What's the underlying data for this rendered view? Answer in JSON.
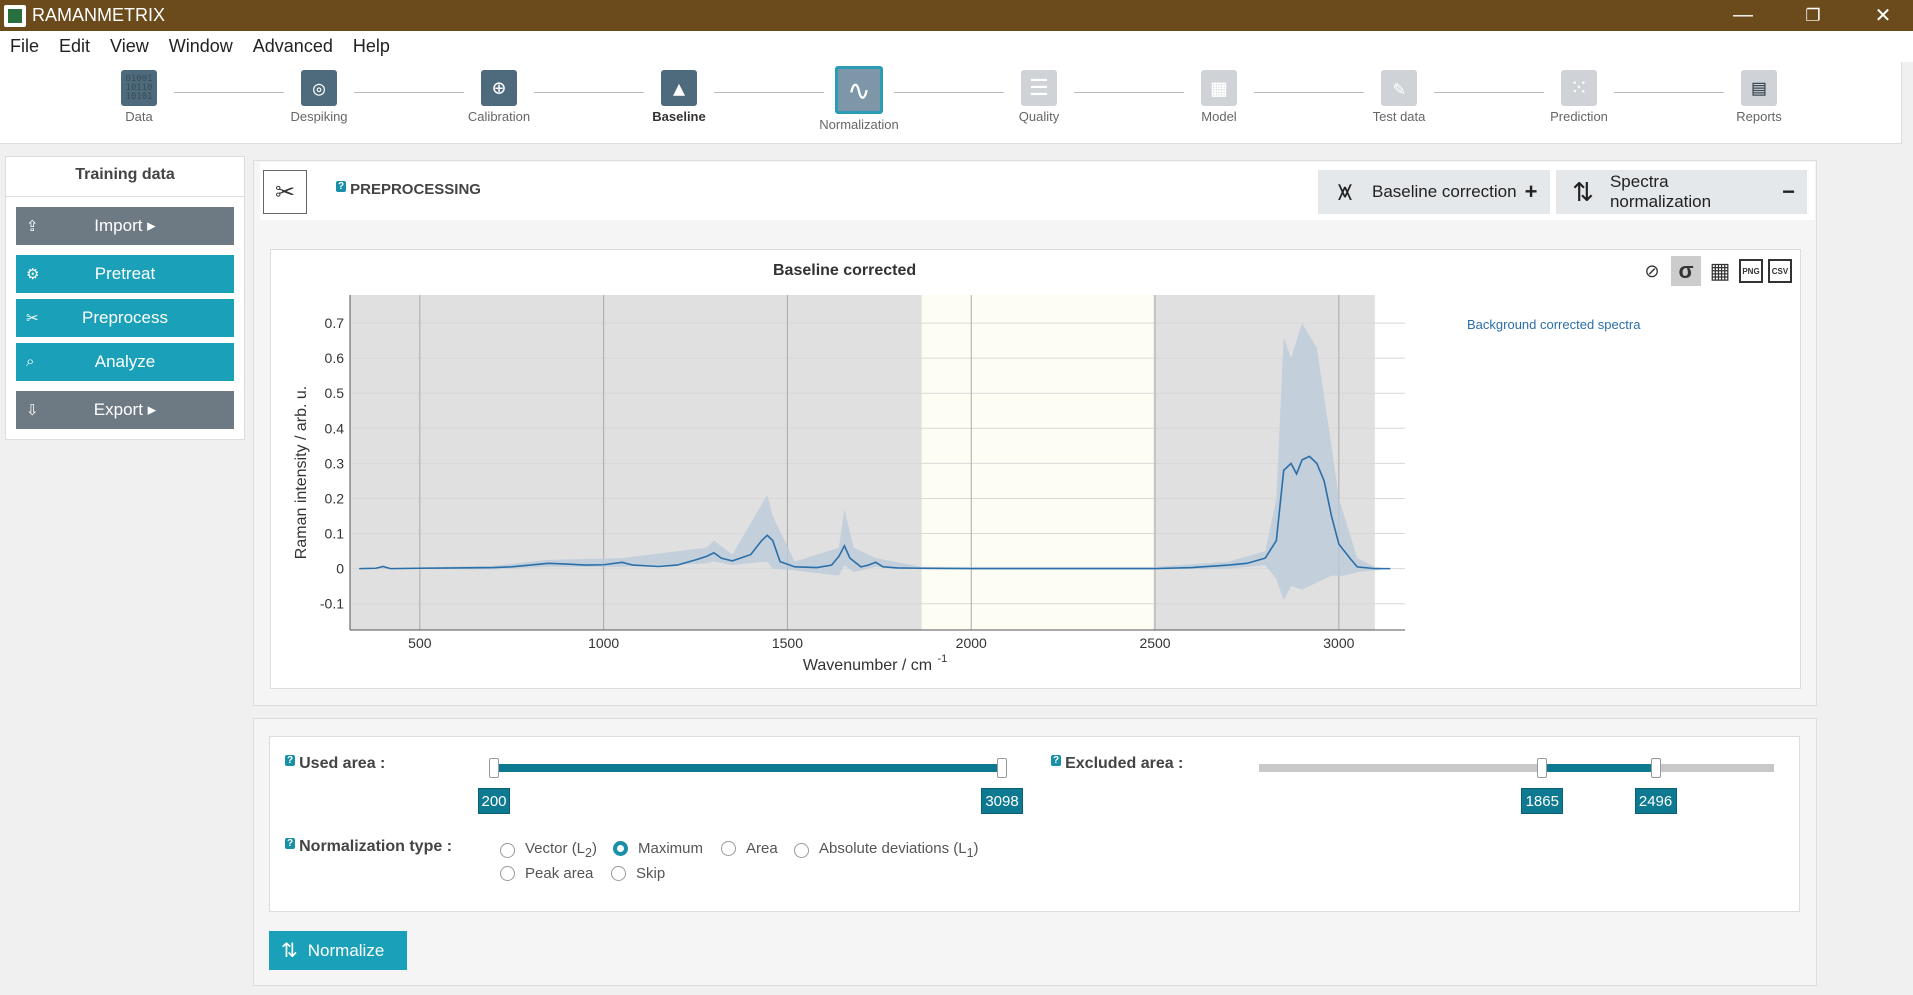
{
  "window": {
    "title": "RAMANMETRIX",
    "minimize": "—",
    "restore": "❐",
    "close": "✕"
  },
  "menu": [
    "File",
    "Edit",
    "View",
    "Window",
    "Advanced",
    "Help"
  ],
  "steps": [
    {
      "label": "Data",
      "icon": "binary-data-icon",
      "glyph": "01001 10110 10101"
    },
    {
      "label": "Despiking",
      "icon": "despiking-icon",
      "glyph": "◎"
    },
    {
      "label": "Calibration",
      "icon": "calibration-icon",
      "glyph": "⊕"
    },
    {
      "label": "Baseline",
      "icon": "baseline-icon",
      "glyph": "▲"
    },
    {
      "label": "Normalization",
      "icon": "normalization-icon",
      "glyph": "∿"
    },
    {
      "label": "Quality",
      "icon": "quality-icon",
      "glyph": "☰"
    },
    {
      "label": "Model",
      "icon": "model-icon",
      "glyph": "▦"
    },
    {
      "label": "Test data",
      "icon": "test-data-icon",
      "glyph": "✎"
    },
    {
      "label": "Prediction",
      "icon": "prediction-icon",
      "glyph": "⁙"
    },
    {
      "label": "Reports",
      "icon": "reports-icon",
      "glyph": "▤"
    }
  ],
  "sidebar": {
    "header": "Training data",
    "buttons": [
      {
        "label": "Import ▸",
        "icon": "upload-icon",
        "glyph": "⇪"
      },
      {
        "label": "Pretreat",
        "icon": "pretreat-icon",
        "glyph": "⚙"
      },
      {
        "label": "Preprocess",
        "icon": "preprocess-icon",
        "glyph": "✂"
      },
      {
        "label": "Analyze",
        "icon": "analyze-icon",
        "glyph": "⌕"
      },
      {
        "label": "Export ▸",
        "icon": "download-icon",
        "glyph": "⇩"
      }
    ]
  },
  "preprocessing": {
    "title": "PREPROCESSING",
    "help": "?",
    "baseline_btn": "Baseline correction",
    "baseline_sign": "+",
    "norm_btn": "Spectra normalization",
    "norm_sign": "−"
  },
  "chart_tools": {
    "png": "PNG",
    "csv": "CSV"
  },
  "chart_data": {
    "type": "line",
    "title": "Baseline corrected",
    "xlabel": "Wavenumber / cm",
    "xlabel_sup": "-1",
    "ylabel": "Raman intensity / arb. u.",
    "xlim": [
      310,
      3180
    ],
    "ylim": [
      -0.175,
      0.78
    ],
    "x_ticks": [
      500,
      1000,
      1500,
      2000,
      2500,
      3000
    ],
    "y_ticks": [
      -0.1,
      0,
      0.1,
      0.2,
      0.3,
      0.4,
      0.5,
      0.6,
      0.7
    ],
    "excluded_region": [
      1865,
      2496
    ],
    "grayed_region": [
      310,
      3098
    ],
    "grid": true,
    "legend_position": "right",
    "series": [
      {
        "name": "Background corrected spectra",
        "color": "#2b6fa8",
        "band_color": "#b9cad9",
        "points": [
          [
            335,
            0
          ],
          [
            380,
            0.001
          ],
          [
            400,
            0.006
          ],
          [
            420,
            0
          ],
          [
            500,
            0.001
          ],
          [
            600,
            0.002
          ],
          [
            700,
            0.003
          ],
          [
            750,
            0.005
          ],
          [
            800,
            0.01
          ],
          [
            850,
            0.015
          ],
          [
            900,
            0.013
          ],
          [
            950,
            0.01
          ],
          [
            1000,
            0.011
          ],
          [
            1050,
            0.018
          ],
          [
            1080,
            0.01
          ],
          [
            1150,
            0.006
          ],
          [
            1200,
            0.01
          ],
          [
            1250,
            0.025
          ],
          [
            1280,
            0.035
          ],
          [
            1300,
            0.045
          ],
          [
            1320,
            0.03
          ],
          [
            1350,
            0.022
          ],
          [
            1400,
            0.04
          ],
          [
            1430,
            0.08
          ],
          [
            1445,
            0.095
          ],
          [
            1460,
            0.08
          ],
          [
            1480,
            0.02
          ],
          [
            1520,
            0.005
          ],
          [
            1580,
            0.003
          ],
          [
            1620,
            0.01
          ],
          [
            1640,
            0.035
          ],
          [
            1655,
            0.065
          ],
          [
            1670,
            0.03
          ],
          [
            1700,
            0.005
          ],
          [
            1720,
            0.01
          ],
          [
            1740,
            0.018
          ],
          [
            1760,
            0.005
          ],
          [
            1800,
            0.002
          ],
          [
            1865,
            0.001
          ],
          [
            2000,
            0
          ],
          [
            2496,
            0
          ],
          [
            2600,
            0.003
          ],
          [
            2700,
            0.01
          ],
          [
            2750,
            0.015
          ],
          [
            2800,
            0.03
          ],
          [
            2830,
            0.08
          ],
          [
            2850,
            0.28
          ],
          [
            2870,
            0.3
          ],
          [
            2885,
            0.27
          ],
          [
            2900,
            0.31
          ],
          [
            2920,
            0.32
          ],
          [
            2940,
            0.3
          ],
          [
            2960,
            0.25
          ],
          [
            2980,
            0.15
          ],
          [
            3000,
            0.07
          ],
          [
            3015,
            0.05
          ],
          [
            3030,
            0.03
          ],
          [
            3050,
            0.005
          ],
          [
            3098,
            0
          ],
          [
            3140,
            0
          ]
        ],
        "band": [
          [
            335,
            0,
            0
          ],
          [
            700,
            0.008,
            -0.002
          ],
          [
            850,
            0.025,
            0.005
          ],
          [
            1050,
            0.03,
            0.005
          ],
          [
            1280,
            0.06,
            0.015
          ],
          [
            1300,
            0.08,
            0.02
          ],
          [
            1350,
            0.04,
            0.01
          ],
          [
            1445,
            0.21,
            0.02
          ],
          [
            1460,
            0.15,
            0.0
          ],
          [
            1520,
            0.02,
            -0.005
          ],
          [
            1640,
            0.06,
            -0.02
          ],
          [
            1655,
            0.17,
            0.01
          ],
          [
            1680,
            0.06,
            -0.01
          ],
          [
            1740,
            0.03,
            0.005
          ],
          [
            1865,
            0.005,
            -0.002
          ],
          [
            2496,
            0.005,
            -0.002
          ],
          [
            2700,
            0.02,
            0.0
          ],
          [
            2800,
            0.05,
            0.01
          ],
          [
            2830,
            0.2,
            -0.03
          ],
          [
            2850,
            0.66,
            -0.09
          ],
          [
            2870,
            0.6,
            -0.05
          ],
          [
            2900,
            0.7,
            -0.06
          ],
          [
            2940,
            0.63,
            -0.04
          ],
          [
            2980,
            0.35,
            -0.02
          ],
          [
            3000,
            0.2,
            -0.02
          ],
          [
            3015,
            0.15,
            -0.02
          ],
          [
            3050,
            0.03,
            -0.01
          ],
          [
            3098,
            0.005,
            -0.005
          ],
          [
            3140,
            0,
            0
          ]
        ]
      }
    ]
  },
  "controls": {
    "used_area_label": "Used area :",
    "used_min": "200",
    "used_max": "3098",
    "used_fraction": [
      0.0,
      1.0
    ],
    "excluded_area_label": "Excluded area :",
    "excluded_min": "1865",
    "excluded_max": "2496",
    "excluded_fraction": [
      0.55,
      0.77
    ],
    "normalization_label": "Normalization type :",
    "options": [
      {
        "label": "Vector (L",
        "sub": "2",
        "tail": ")",
        "selected": false
      },
      {
        "label": "Maximum",
        "sub": "",
        "tail": "",
        "selected": true
      },
      {
        "label": "Area",
        "sub": "",
        "tail": "",
        "selected": false
      },
      {
        "label": "Absolute deviations (L",
        "sub": "1",
        "tail": ")",
        "selected": false
      },
      {
        "label": "Peak area",
        "sub": "",
        "tail": "",
        "selected": false
      },
      {
        "label": "Skip",
        "sub": "",
        "tail": "",
        "selected": false
      }
    ],
    "normalize_btn": "Normalize"
  }
}
